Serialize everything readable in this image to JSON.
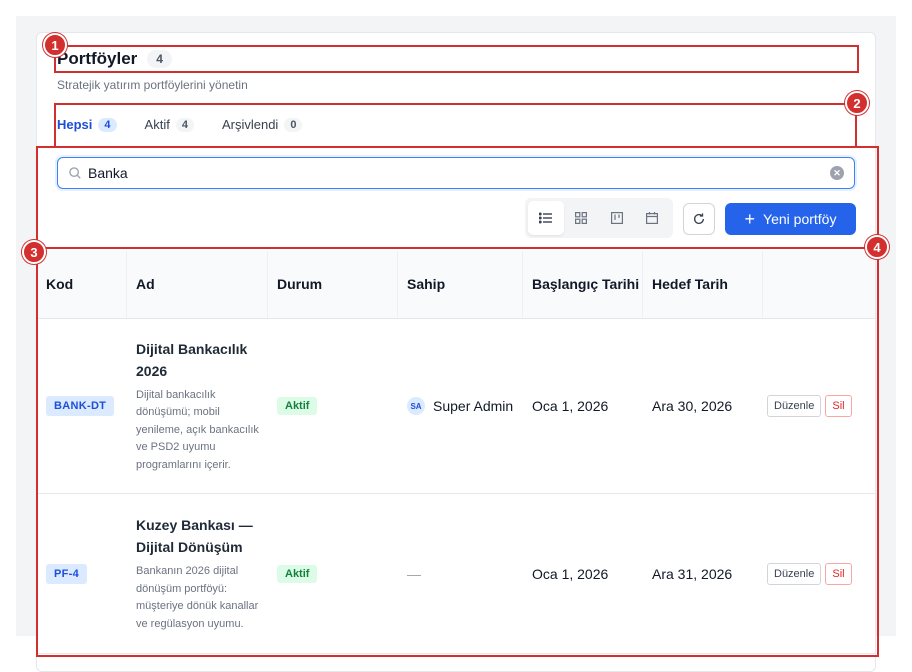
{
  "header": {
    "title": "Portföyler",
    "count": "4",
    "subtitle": "Stratejik yatırım portföylerini yönetin"
  },
  "tabs": [
    {
      "label": "Hepsi",
      "count": "4",
      "active": true
    },
    {
      "label": "Aktif",
      "count": "4",
      "active": false
    },
    {
      "label": "Arşivlendi",
      "count": "0",
      "active": false
    }
  ],
  "search": {
    "value": "Banka",
    "placeholder": ""
  },
  "toolbar": {
    "views": [
      "list-icon",
      "grid-icon",
      "board-icon",
      "calendar-icon"
    ],
    "active_view": "list-icon",
    "new_button_label": "Yeni portföy"
  },
  "table": {
    "columns": [
      "Kod",
      "Ad",
      "Durum",
      "Sahip",
      "Başlangıç Tarihi",
      "Hedef Tarih",
      ""
    ],
    "rows": [
      {
        "code": "BANK-DT",
        "name": "Dijital Bankacılık 2026",
        "description": "Dijital bankacılık dönüşümü; mobil yenileme, açık bankacılık ve PSD2 uyumu programlarını içerir.",
        "status": "Aktif",
        "owner_initials": "SA",
        "owner": "Super Admin",
        "start": "Oca 1, 2026",
        "target": "Ara 30, 2026",
        "edit_label": "Düzenle",
        "delete_label": "Sil"
      },
      {
        "code": "PF-4",
        "name": "Kuzey Bankası — Dijital Dönüşüm",
        "description": "Bankanın 2026 dijital dönüşüm portföyü: müşteriye dönük kanallar ve regülasyon uyumu.",
        "status": "Aktif",
        "owner_initials": "",
        "owner": "—",
        "start": "Oca 1, 2026",
        "target": "Ara 31, 2026",
        "edit_label": "Düzenle",
        "delete_label": "Sil"
      }
    ]
  },
  "annotations": [
    "1",
    "2",
    "3",
    "4"
  ],
  "colors": {
    "accent": "#2563eb",
    "annotation": "#d32f2f",
    "status_green": "#15803d"
  }
}
